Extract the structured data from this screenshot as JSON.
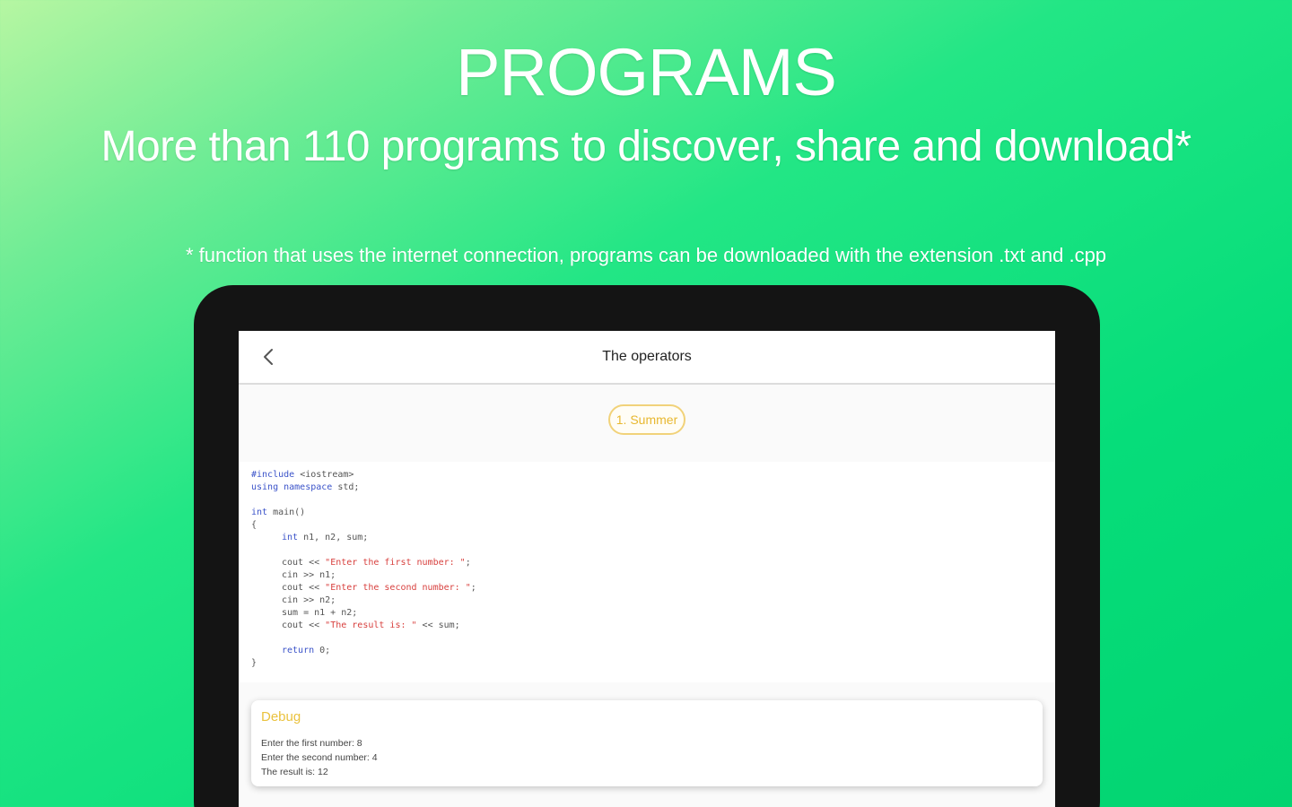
{
  "promo": {
    "heading": "PROGRAMS",
    "subheading": "More than 110 programs to discover, share and download*",
    "footnote": "* function that uses the internet connection, programs can be downloaded with the extension .txt and .cpp"
  },
  "appbar": {
    "back_icon": "chevron-left-icon",
    "title": "The operators"
  },
  "chip": {
    "label": "1. Summer"
  },
  "code": {
    "line_1_kw": "#include",
    "line_1_rest": " <iostream>",
    "line_2_kw": "using namespace",
    "line_2_rest": " std;",
    "line_4_kw": "int",
    "line_4_rest": " main()",
    "line_5": "{",
    "line_6_kw": "int",
    "line_6_rest": " n1, n2, sum;",
    "line_8_a": "cout << ",
    "line_8_str": "\"Enter the first number: \"",
    "line_8_b": ";",
    "line_9": "cin >> n1;",
    "line_10_a": "cout << ",
    "line_10_str": "\"Enter the second number: \"",
    "line_10_b": ";",
    "line_11": "cin >> n2;",
    "line_12": "sum = n1 + n2;",
    "line_13_a": "cout << ",
    "line_13_str": "\"The result is: \"",
    "line_13_b": " << sum;",
    "line_15_kw": "return",
    "line_15_rest": " 0;",
    "line_16": "}"
  },
  "debug": {
    "title": "Debug",
    "line_1": "Enter the first number: 8",
    "line_2": "Enter the second number: 4",
    "line_3": "The result is: 12"
  },
  "colors": {
    "background_start": "#b6f6a2",
    "background_end": "#03d471",
    "accent_yellow": "#eac23e",
    "keyword_blue": "#3b53c9",
    "string_red": "#d8413f"
  }
}
